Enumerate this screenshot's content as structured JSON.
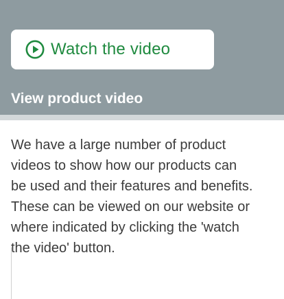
{
  "header": {
    "watch_button": {
      "icon": "play-circle-icon",
      "label": "Watch the video"
    },
    "title": "View product video"
  },
  "body": {
    "lines": [
      "We have a large number of product",
      "videos to show how our products can",
      "be used and their features and benefits.",
      "These can be viewed on our website or",
      "where indicated by clicking the 'watch",
      "the video' button."
    ]
  },
  "colors": {
    "header_bg": "#8e9ba0",
    "accent_green": "#1f8a3f",
    "divider": "#d3d8da",
    "text": "#3b3b3b"
  }
}
